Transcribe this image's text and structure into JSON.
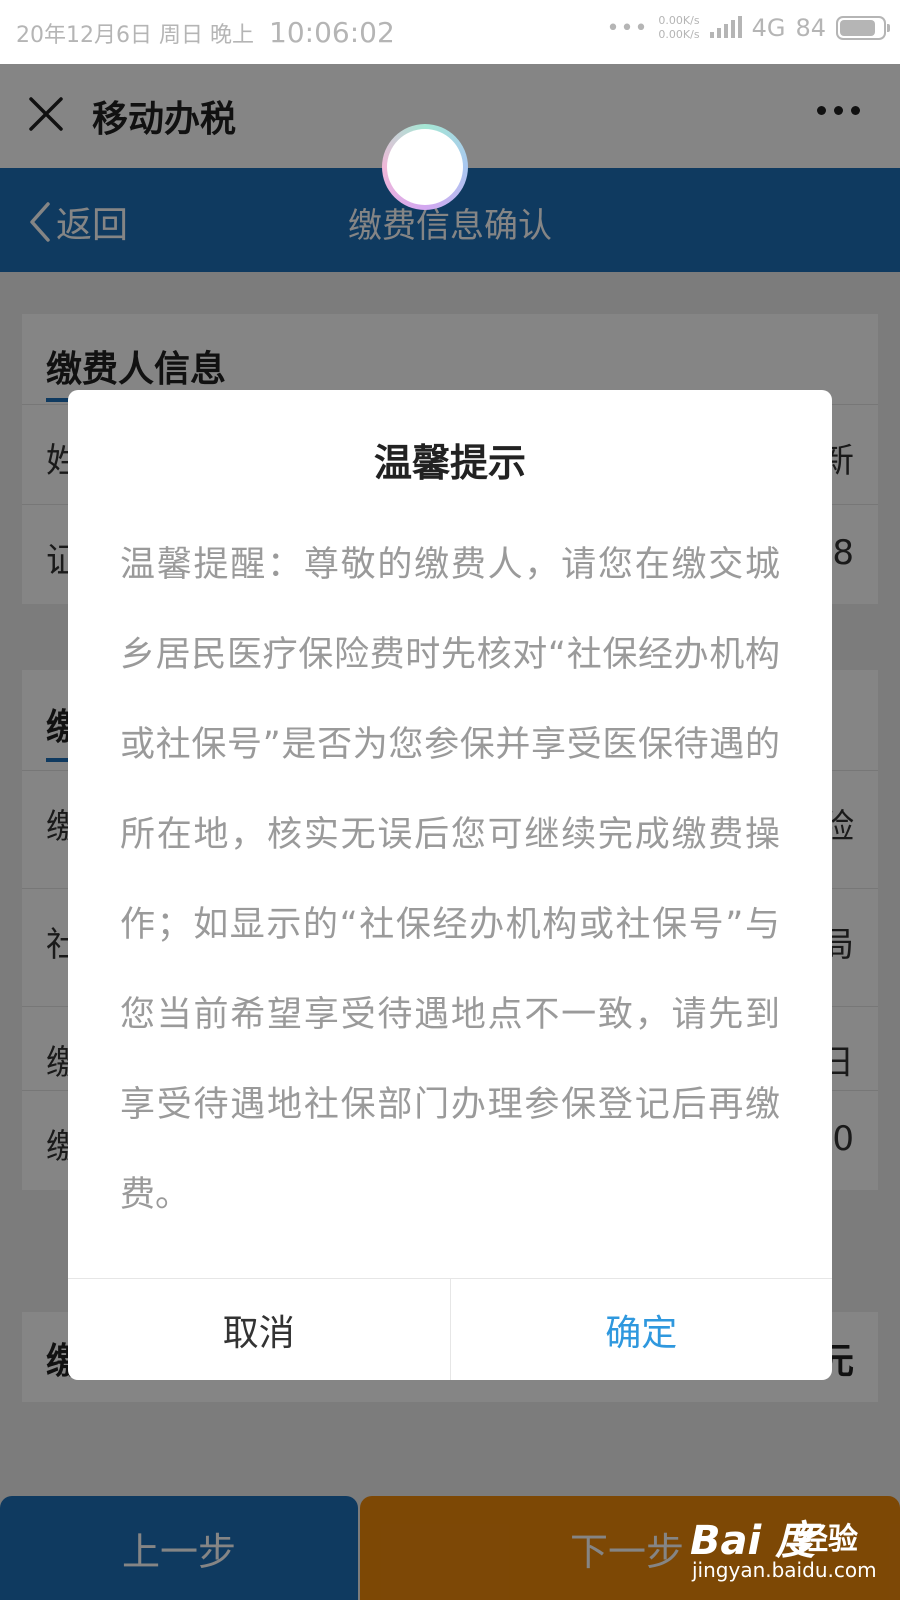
{
  "status_bar": {
    "date": "20年12月6日",
    "weekday": "周日",
    "period": "晚上",
    "time": "10:06:02",
    "speed_up": "0.00K/s",
    "speed_down": "0.00K/s",
    "network": "4G",
    "network_sub": "ₗₗ",
    "battery": "84",
    "battery_level": 0.84
  },
  "app_bar": {
    "title": "移动办税"
  },
  "header": {
    "back_label": "返回",
    "title": "缴费信息确认",
    "bg_color": "#1e6fb8"
  },
  "background": {
    "section1_title": "缴费人信息",
    "section1_rows": [
      {
        "label": "姓",
        "value": "新"
      },
      {
        "label": "证",
        "value": "8"
      }
    ],
    "section2_title": "缴",
    "section2_rows": [
      {
        "label": "缴",
        "value": "险"
      },
      {
        "label": "社",
        "value": "局"
      },
      {
        "label": "缴",
        "value": "日"
      },
      {
        "label": "缴",
        "value": "0"
      }
    ],
    "total_label": "缴",
    "total_value": "元"
  },
  "dialog": {
    "title": "温馨提示",
    "message": "温馨提醒：尊敬的缴费人，请您在缴交城乡居民医疗保险费时先核对“社保经办机构或社保号”是否为您参保并享受医保待遇的所在地，核实无误后您可继续完成缴费操作；如显示的“社保经办机构或社保号”与您当前希望享受待遇地点不一致，请先到享受待遇地社保部门办理参保登记后再缴费。",
    "cancel_label": "取消",
    "confirm_label": "确定",
    "confirm_color": "#2f98de"
  },
  "footer": {
    "prev_label": "上一步",
    "next_label": "下一步",
    "prev_color": "#1e6fb8",
    "next_color": "#ef8a0b"
  },
  "watermark": {
    "logo": "Bai 度",
    "logo_suffix": "经验",
    "url": "jingyan.baidu.com"
  }
}
